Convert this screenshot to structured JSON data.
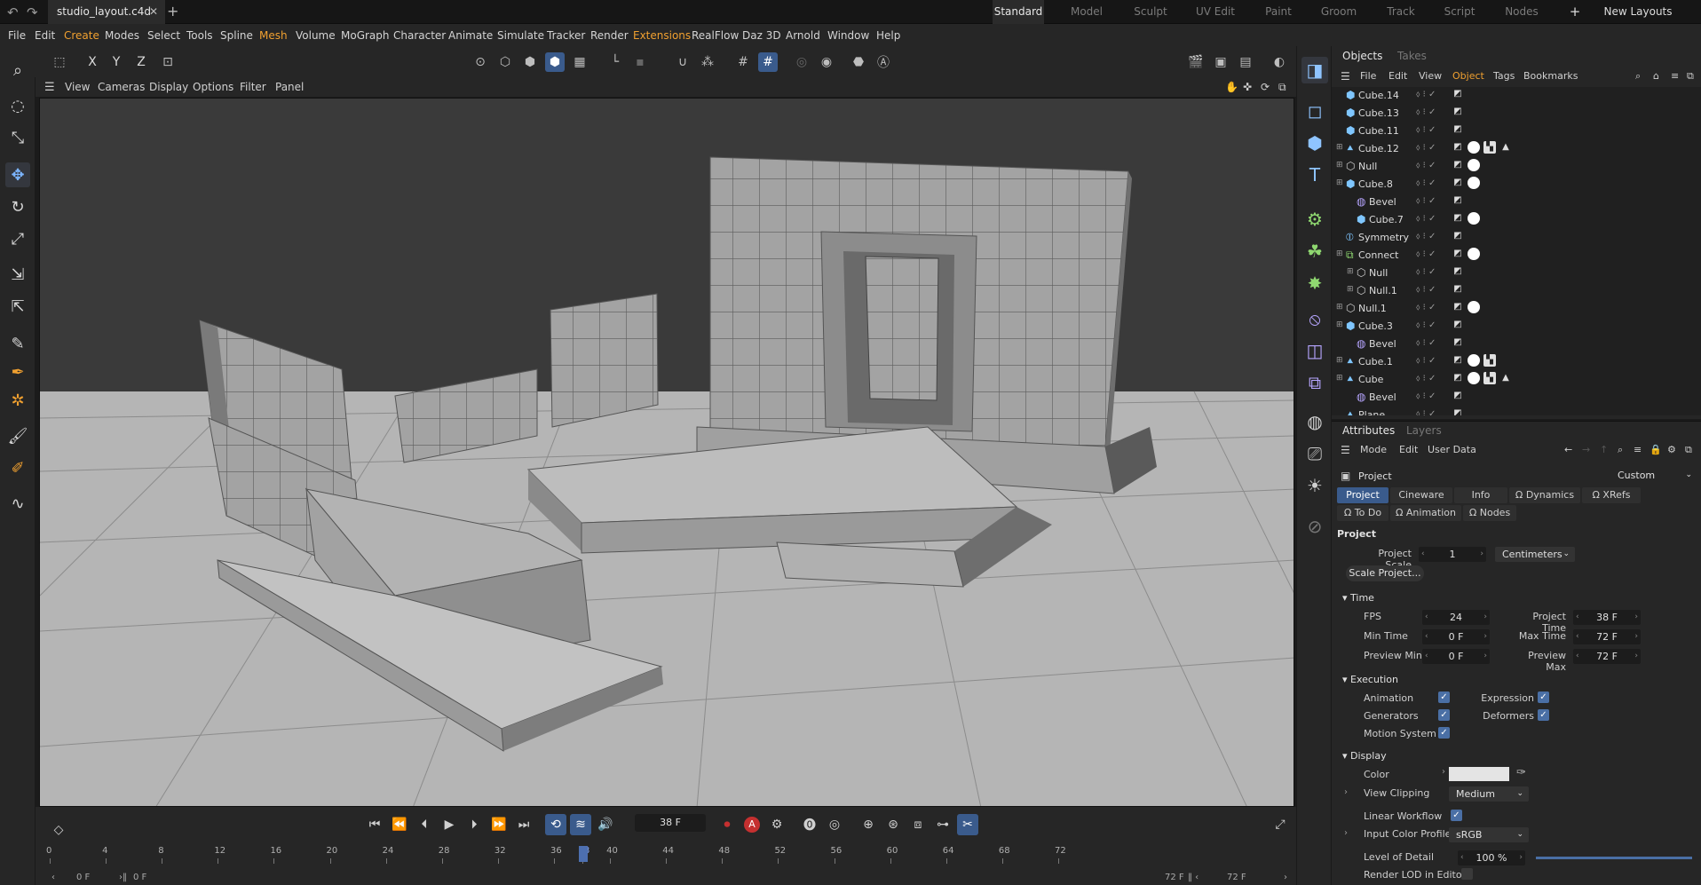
{
  "doc_tab": {
    "title": "studio_layout.c4d"
  },
  "layouts": [
    {
      "label": "Standard",
      "active": true
    },
    {
      "label": "Model"
    },
    {
      "label": "Sculpt"
    },
    {
      "label": "UV Edit"
    },
    {
      "label": "Paint"
    },
    {
      "label": "Groom"
    },
    {
      "label": "Track"
    },
    {
      "label": "Script"
    },
    {
      "label": "Nodes"
    }
  ],
  "new_layouts": "New Layouts",
  "menu": [
    "File",
    "Edit",
    "Create",
    "Modes",
    "Select",
    "Tools",
    "Spline",
    "Mesh",
    "Volume",
    "MoGraph",
    "Character",
    "Animate",
    "Simulate",
    "Tracker",
    "Render",
    "Extensions",
    "RealFlow",
    "Daz 3D",
    "Arnold",
    "Window",
    "Help"
  ],
  "toolbar": {
    "x": "X",
    "y": "Y",
    "z": "Z"
  },
  "viewport_menu": [
    "View",
    "Cameras",
    "Display",
    "Options",
    "Filter",
    "Panel"
  ],
  "timeline": {
    "frame": "38 F",
    "ticks": [
      "0",
      "4",
      "8",
      "12",
      "16",
      "20",
      "24",
      "28",
      "32",
      "36",
      "38",
      "40",
      "44",
      "48",
      "52",
      "56",
      "60",
      "64",
      "68",
      "72"
    ],
    "current": 38,
    "range_start": "0 F",
    "range_start2": "0 F",
    "range_end": "72 F",
    "range_end2": "72 F"
  },
  "objects_panel": {
    "tab_objects": "Objects",
    "tab_takes": "Takes",
    "menu": [
      "File",
      "Edit",
      "View",
      "Object",
      "Tags",
      "Bookmarks"
    ],
    "items": [
      {
        "name": "Cube.14",
        "depth": 0,
        "icon": "cube"
      },
      {
        "name": "Cube.13",
        "depth": 0,
        "icon": "cube"
      },
      {
        "name": "Cube.11",
        "depth": 0,
        "icon": "cube"
      },
      {
        "name": "Cube.12",
        "depth": 0,
        "icon": "figure",
        "expand": true
      },
      {
        "name": "Null",
        "depth": 0,
        "icon": "null",
        "expand": true
      },
      {
        "name": "Cube.8",
        "depth": 0,
        "icon": "cube",
        "expand": true
      },
      {
        "name": "Bevel",
        "depth": 1,
        "icon": "bevel"
      },
      {
        "name": "Cube.7",
        "depth": 1,
        "icon": "cube"
      },
      {
        "name": "Symmetry",
        "depth": 0,
        "icon": "symmetry"
      },
      {
        "name": "Connect",
        "depth": 0,
        "icon": "connect",
        "expand": true
      },
      {
        "name": "Null",
        "depth": 1,
        "icon": "null",
        "expand": true
      },
      {
        "name": "Null.1",
        "depth": 1,
        "icon": "null",
        "expand": true
      },
      {
        "name": "Null.1",
        "depth": 0,
        "icon": "null",
        "expand": true
      },
      {
        "name": "Cube.3",
        "depth": 0,
        "icon": "cube",
        "expand": true
      },
      {
        "name": "Bevel",
        "depth": 1,
        "icon": "bevel"
      },
      {
        "name": "Cube.1",
        "depth": 0,
        "icon": "figure",
        "expand": true
      },
      {
        "name": "Cube",
        "depth": 0,
        "icon": "figure",
        "expand": true
      },
      {
        "name": "Bevel",
        "depth": 1,
        "icon": "bevel"
      },
      {
        "name": "Plane",
        "depth": 0,
        "icon": "figure"
      }
    ]
  },
  "attributes": {
    "tab_attributes": "Attributes",
    "tab_layers": "Layers",
    "menu": [
      "Mode",
      "Edit",
      "User Data"
    ],
    "object": "Project",
    "custom": "Custom",
    "tabs_row1": [
      "Project",
      "Cineware",
      "Info",
      "Ω Dynamics",
      "Ω XRefs"
    ],
    "tabs_row2": [
      "Ω To Do",
      "Ω Animation",
      "Ω Nodes"
    ],
    "section_project": "Project",
    "project_scale_label": "Project Scale",
    "project_scale": "1",
    "project_scale_unit": "Centimeters",
    "scale_button": "Scale Project...",
    "section_time": "Time",
    "fps_label": "FPS",
    "fps": "24",
    "project_time_label": "Project Time",
    "project_time": "38 F",
    "min_time_label": "Min Time",
    "min_time": "0 F",
    "max_time_label": "Max Time",
    "max_time": "72 F",
    "preview_min_label": "Preview Min",
    "preview_min": "0 F",
    "preview_max_label": "Preview Max",
    "preview_max": "72 F",
    "section_execution": "Execution",
    "animation_label": "Animation",
    "expression_label": "Expression",
    "generators_label": "Generators",
    "deformers_label": "Deformers",
    "motion_label": "Motion System",
    "section_display": "Display",
    "color_label": "Color",
    "view_clipping_label": "View Clipping",
    "view_clipping": "Medium",
    "linear_label": "Linear Workflow",
    "input_profile_label": "Input Color Profile",
    "input_profile": "sRGB",
    "lod_label": "Level of Detail",
    "lod": "100 %",
    "render_lod_label": "Render LOD in Editor"
  }
}
